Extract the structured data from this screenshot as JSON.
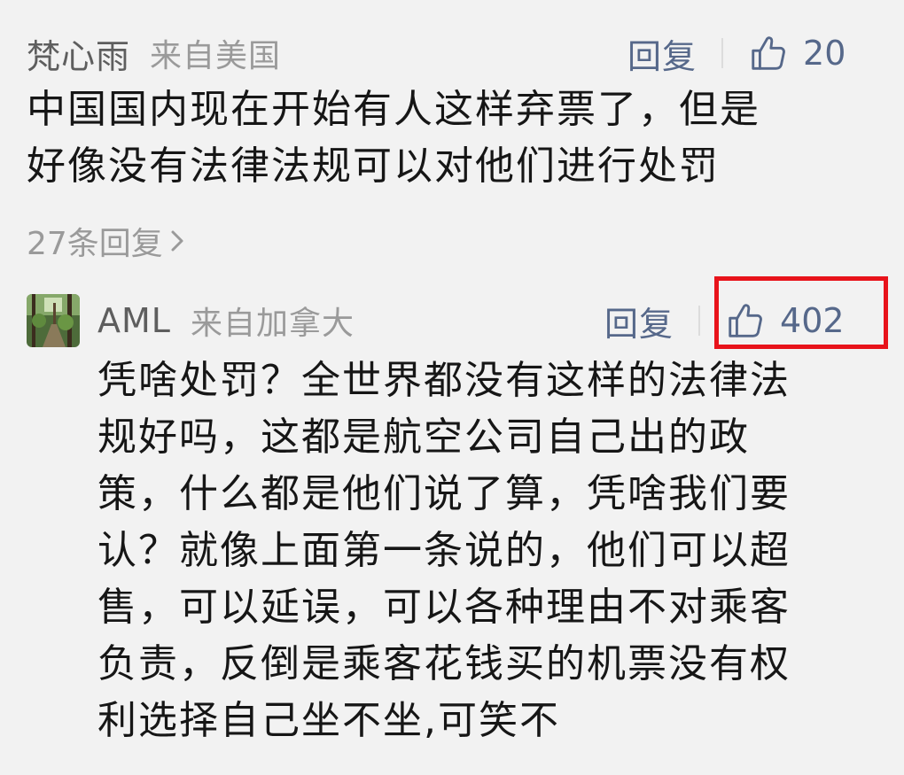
{
  "comments": [
    {
      "username": "梵心雨",
      "location": "来自美国",
      "reply_label": "回复",
      "like_count": "20",
      "text_lines": [
        "中国国内现在开始有人这样弃票了，但是",
        "好像没有法律法规可以对他们进行处罚"
      ],
      "more_replies": "27条回复"
    },
    {
      "username": "AML",
      "location": "来自加拿大",
      "reply_label": "回复",
      "like_count": "402",
      "text_lines": [
        "凭啥处罚？全世界都没有这样的法律法",
        "规好吗，这都是航空公司自己出的政",
        "策，什么都是他们说了算，凭啥我们要",
        "认？就像上面第一条说的，他们可以超",
        "售，可以延误，可以各种理由不对乘客",
        "负责，反倒是乘客花钱买的机票没有权",
        "利选择自己坐不坐,可笑不"
      ]
    }
  ],
  "icons": {
    "like": "thumbs-up-icon",
    "chevron": "chevron-right-icon"
  },
  "colors": {
    "link": "#56688a",
    "highlight": "#e8131b",
    "background": "#f2f2f2"
  }
}
